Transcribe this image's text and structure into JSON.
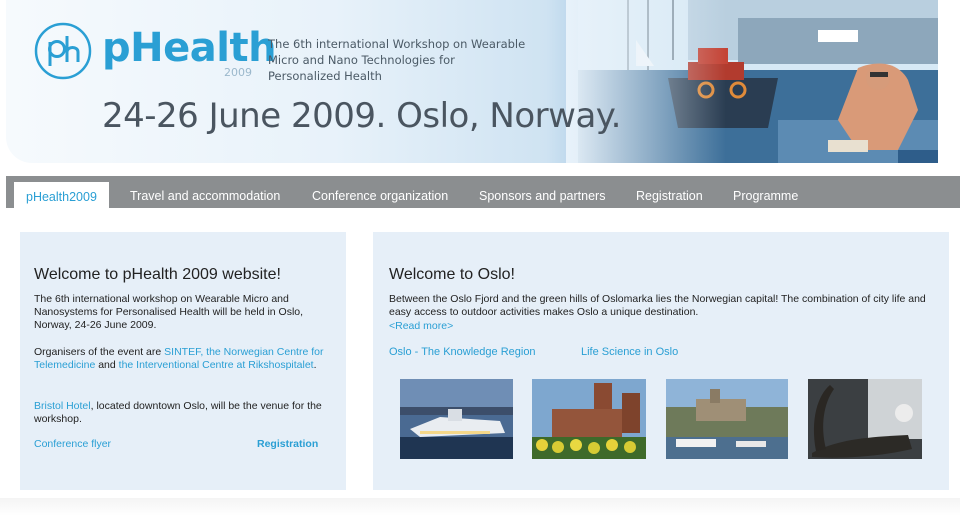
{
  "header": {
    "logo_text": "pHealth",
    "logo_year": "2009",
    "tagline": "The 6th international Workshop on Wearable Micro and Nano Technologies for Personalized Health",
    "dateline": "24-26 June 2009. Oslo, Norway."
  },
  "nav": {
    "items": [
      {
        "label": "pHealth2009",
        "active": true
      },
      {
        "label": "Travel and accommodation"
      },
      {
        "label": "Conference organization"
      },
      {
        "label": "Sponsors and partners"
      },
      {
        "label": "Registration"
      },
      {
        "label": "Programme"
      }
    ]
  },
  "left": {
    "title": "Welcome to pHealth 2009 website!",
    "intro": "The 6th international workshop on Wearable Micro and Nanosystems for Personalised Health will be held in Oslo, Norway, 24-26 June 2009.",
    "organisers_prefix": "Organisers of the event are ",
    "sintef": "SINTEF",
    "sep1": ", ",
    "norwegian_centre": "the Norwegian Centre for Telemedicine",
    "and": " and ",
    "interventional": "the Interventional Centre at Rikshospitalet",
    "period": ".",
    "bristol": "Bristol Hotel",
    "bristol_suffix": ", located downtown Oslo, will be the venue for the workshop.",
    "flyer": "Conference flyer",
    "registration": "Registration"
  },
  "right": {
    "title": "Welcome to Oslo!",
    "body": "Between the Oslo Fjord and the green hills of Oslomarka lies the Norwegian capital! The combination of city life and easy access to outdoor activities makes Oslo a unique destination.",
    "read_more": "<Read more>",
    "link1": "Oslo - The Knowledge Region",
    "link2": "Life Science in Oslo"
  },
  "colors": {
    "accent": "#2a9fd4",
    "nav_bg": "#8b8e90",
    "panel_bg": "#e6eff8"
  }
}
